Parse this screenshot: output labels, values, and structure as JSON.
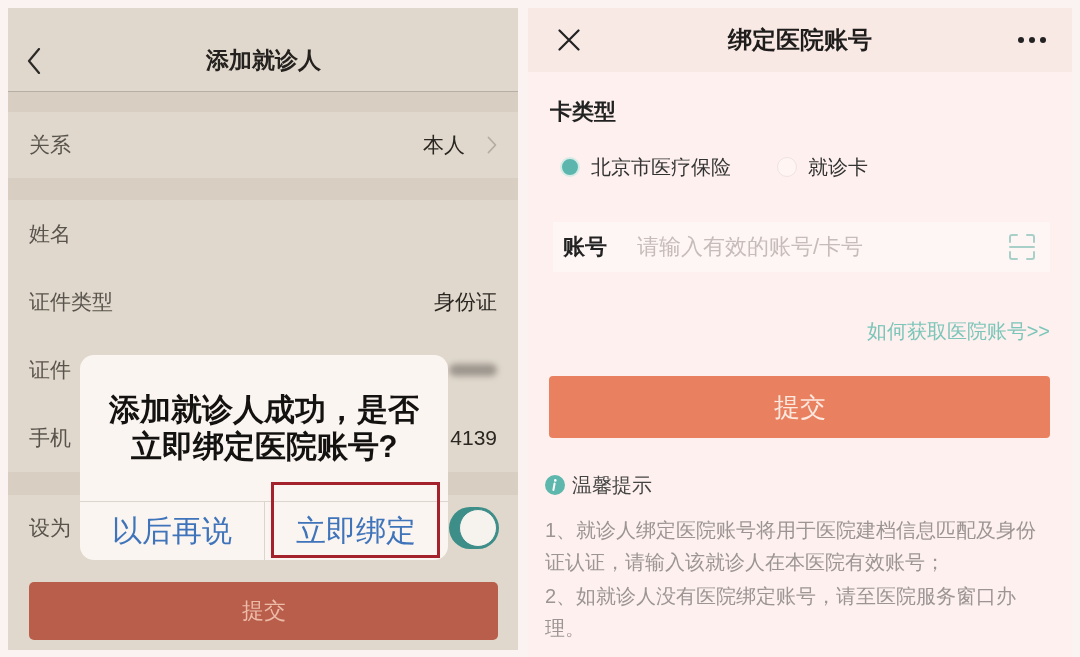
{
  "left_screen": {
    "title": "添加就诊人",
    "sections": [
      [
        {
          "kind": "link",
          "label": "关系",
          "value": "本人"
        }
      ],
      [
        {
          "kind": "text",
          "label": "姓名"
        },
        {
          "kind": "text",
          "label": "证件类型",
          "value": "身份证"
        },
        {
          "kind": "text",
          "label": "证件",
          "redacted": true
        },
        {
          "kind": "text",
          "label": "手机",
          "value": "4139"
        }
      ],
      [
        {
          "kind": "toggle",
          "label": "设为",
          "on": true
        }
      ]
    ],
    "submit_button": "提交"
  },
  "dialog": {
    "message": "添加就诊人成功，是否立即绑定医院账号?",
    "buttons": [
      {
        "label": "以后再说",
        "highlighted": false
      },
      {
        "label": "立即绑定",
        "highlighted": true
      }
    ]
  },
  "right_screen": {
    "title": "绑定医院账号",
    "card_type_label": "卡类型",
    "card_types": [
      {
        "label": "北京市医疗保险",
        "selected": true
      },
      {
        "label": "就诊卡",
        "selected": false
      }
    ],
    "account_field": {
      "label": "账号",
      "placeholder": "请输入有效的账号/卡号"
    },
    "help_link": "如何获取医院账号>>",
    "submit_button": "提交",
    "tips": {
      "title": "温馨提示",
      "items": [
        "1、就诊人绑定医院账号将用于医院建档信息匹配及身份证认证，请输入该就诊人在本医院有效账号；",
        "2、如就诊人没有医院绑定账号，请至医院服务窗口办理。"
      ]
    }
  }
}
